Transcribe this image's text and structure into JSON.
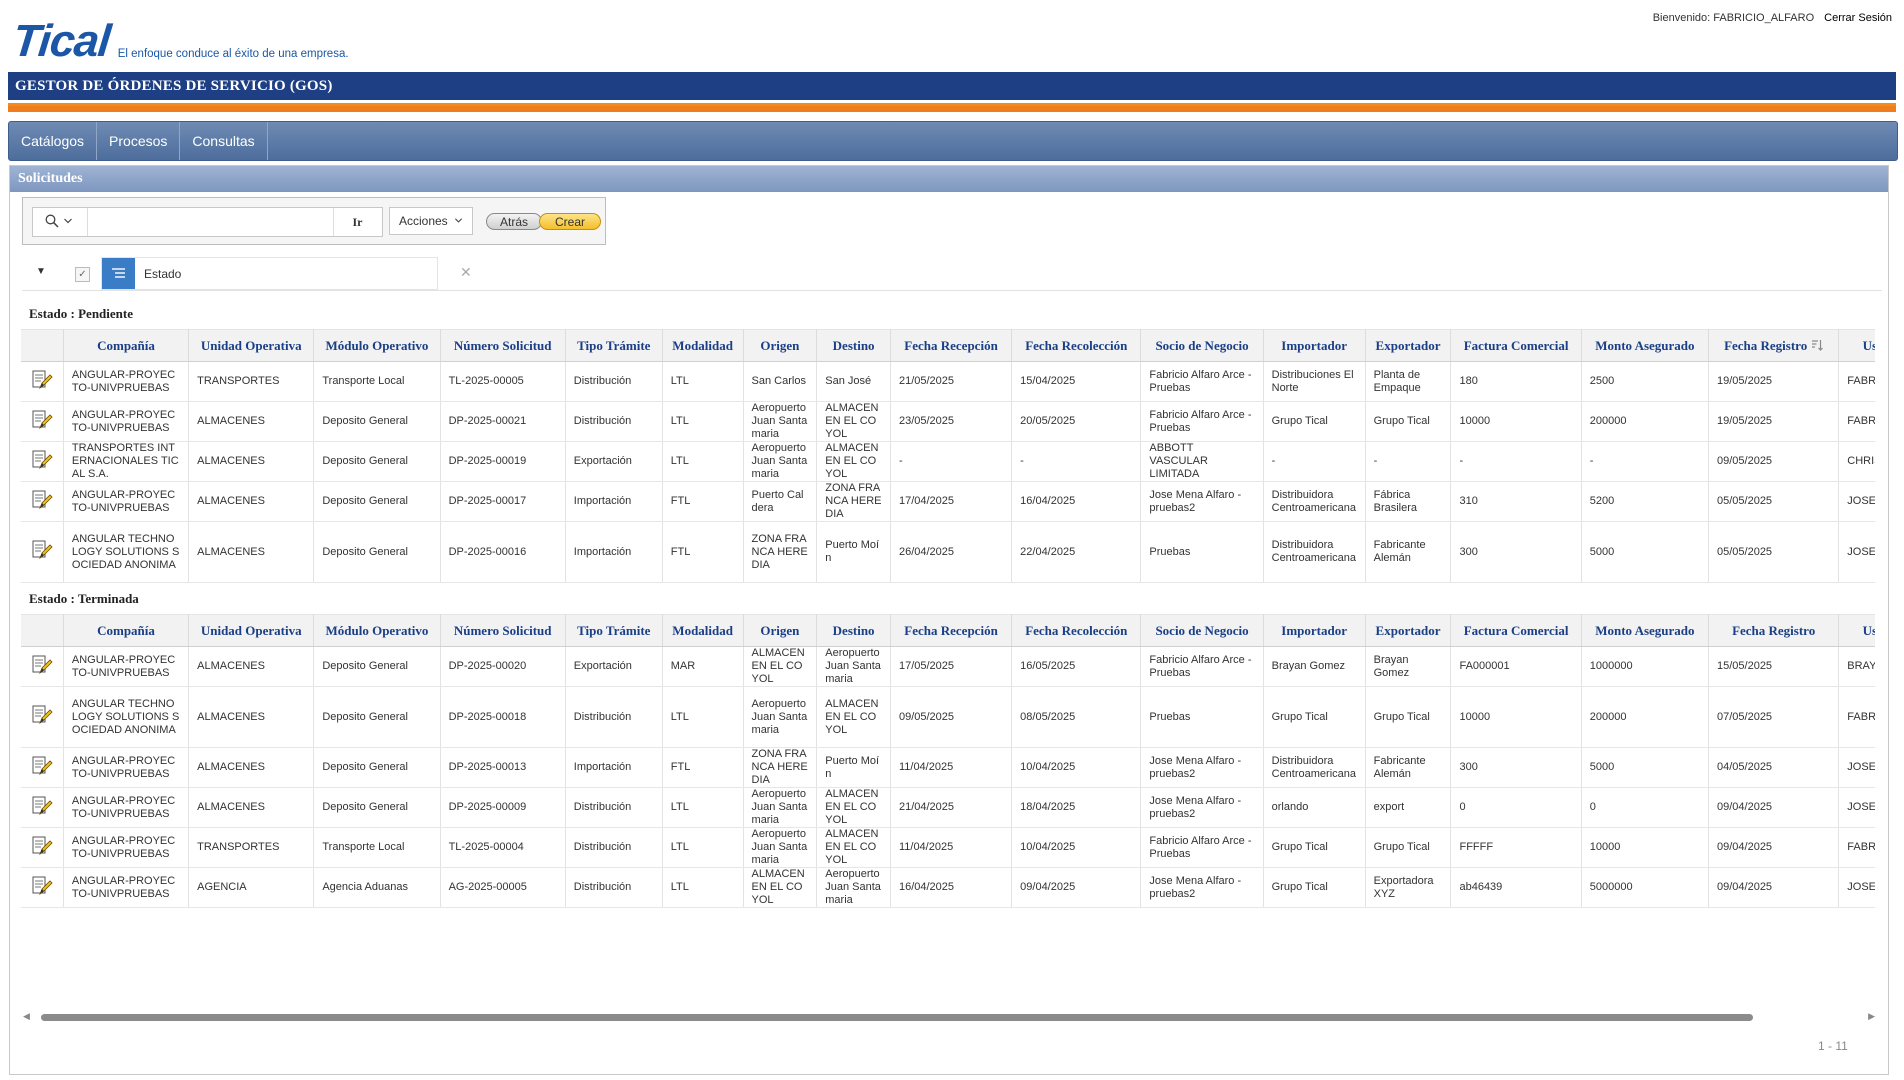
{
  "header": {
    "logo": "Tical",
    "tagline": "El enfoque conduce al éxito de una empresa.",
    "welcome": "Bienvenido: FABRICIO_ALFARO",
    "logout": "Cerrar Sesión",
    "app_title": "GESTOR DE ÓRDENES DE SERVICIO (GOS)"
  },
  "nav": [
    "Catálogos",
    "Procesos",
    "Consultas"
  ],
  "region": {
    "title": "Solicitudes",
    "toolbar": {
      "go": "Ir",
      "actions": "Acciones",
      "back": "Atrás",
      "create": "Crear",
      "search_value": ""
    },
    "filter": {
      "label": "Estado",
      "toggle": "▼",
      "check": "✓",
      "remove": "✕"
    }
  },
  "columns": [
    "Compañía",
    "Unidad Operativa",
    "Módulo Operativo",
    "Número Solicitud",
    "Tipo Trámite",
    "Modalidad",
    "Origen",
    "Destino",
    "Fecha Recepción",
    "Fecha Recolección",
    "Socio de Negocio",
    "Importador",
    "Exportador",
    "Factura Comercial",
    "Monto Asegurado",
    "Fecha Registro",
    "Usuario Registro"
  ],
  "groups": [
    {
      "label": "Estado : Pendiente",
      "rows": [
        [
          "ANGULAR-PROYECTO-UNIVPRUEBAS",
          "TRANSPORTES",
          "Transporte Local",
          "TL-2025-00005",
          "Distribución",
          "LTL",
          "San Carlos",
          "San José",
          "21/05/2025",
          "15/04/2025",
          "Fabricio Alfaro Arce - Pruebas",
          "Distribuciones El Norte",
          "Planta de Empaque",
          "180",
          "2500",
          "19/05/2025",
          "FABRICIO_ALFARO"
        ],
        [
          "ANGULAR-PROYECTO-UNIVPRUEBAS",
          "ALMACENES",
          "Deposito General",
          "DP-2025-00021",
          "Distribución",
          "LTL",
          "Aeropuerto Juan Santamaria",
          "ALMACEN EN EL COYOL",
          "23/05/2025",
          "20/05/2025",
          "Fabricio Alfaro Arce - Pruebas",
          "Grupo Tical",
          "Grupo Tical",
          "10000",
          "200000",
          "19/05/2025",
          "FABRICIO_ALFARO"
        ],
        [
          "TRANSPORTES INTERNACIONALES TICAL S.A.",
          "ALMACENES",
          "Deposito General",
          "DP-2025-00019",
          "Exportación",
          "LTL",
          "Aeropuerto Juan Santamaria",
          "ALMACEN EN EL COYOL",
          "-",
          "-",
          "ABBOTT VASCULAR LIMITADA",
          "-",
          "-",
          "-",
          "-",
          "09/05/2025",
          "CHRISTIAN_RODRIGUEZ"
        ],
        [
          "ANGULAR-PROYECTO-UNIVPRUEBAS",
          "ALMACENES",
          "Deposito General",
          "DP-2025-00017",
          "Importación",
          "FTL",
          "Puerto Caldera",
          "ZONA FRANCA HEREDIA",
          "17/04/2025",
          "16/04/2025",
          "Jose Mena Alfaro - pruebas2",
          "Distribuidora Centroamericana",
          "Fábrica Brasilera",
          "310",
          "5200",
          "05/05/2025",
          "JOSE_MENA"
        ],
        [
          "ANGULAR TECHNOLOGY SOLUTIONS SOCIEDAD ANONIMA",
          "ALMACENES",
          "Deposito General",
          "DP-2025-00016",
          "Importación",
          "FTL",
          "ZONA FRANCA HEREDIA",
          "Puerto Moín",
          "26/04/2025",
          "22/04/2025",
          "Pruebas",
          "Distribuidora Centroamericana",
          "Fabricante Alemán",
          "300",
          "5000",
          "05/05/2025",
          "JOSE_MENA"
        ]
      ]
    },
    {
      "label": "Estado : Terminada",
      "rows": [
        [
          "ANGULAR-PROYECTO-UNIVPRUEBAS",
          "ALMACENES",
          "Deposito General",
          "DP-2025-00020",
          "Exportación",
          "MAR",
          "ALMACEN EN EL COYOL",
          "Aeropuerto Juan Santamaria",
          "17/05/2025",
          "16/05/2025",
          "Fabricio Alfaro Arce - Pruebas",
          "Brayan Gomez",
          "Brayan Gomez",
          "FA000001",
          "1000000",
          "15/05/2025",
          "BRAYAN_GOMEZ"
        ],
        [
          "ANGULAR TECHNOLOGY SOLUTIONS SOCIEDAD ANONIMA",
          "ALMACENES",
          "Deposito General",
          "DP-2025-00018",
          "Distribución",
          "LTL",
          "Aeropuerto Juan Santamaria",
          "ALMACEN EN EL COYOL",
          "09/05/2025",
          "08/05/2025",
          "Pruebas",
          "Grupo Tical",
          "Grupo Tical",
          "10000",
          "200000",
          "07/05/2025",
          "FABRICIO_ALFARO"
        ],
        [
          "ANGULAR-PROYECTO-UNIVPRUEBAS",
          "ALMACENES",
          "Deposito General",
          "DP-2025-00013",
          "Importación",
          "FTL",
          "ZONA FRANCA HEREDIA",
          "Puerto Moín",
          "11/04/2025",
          "10/04/2025",
          "Jose Mena Alfaro - pruebas2",
          "Distribuidora Centroamericana",
          "Fabricante Alemán",
          "300",
          "5000",
          "04/05/2025",
          "JOSE_MENA"
        ],
        [
          "ANGULAR-PROYECTO-UNIVPRUEBAS",
          "ALMACENES",
          "Deposito General",
          "DP-2025-00009",
          "Distribución",
          "LTL",
          "Aeropuerto Juan Santamaria",
          "ALMACEN EN EL COYOL",
          "21/04/2025",
          "18/04/2025",
          "Jose Mena Alfaro - pruebas2",
          "orlando",
          "export",
          "0",
          "0",
          "09/04/2025",
          "JOSE_MENA"
        ],
        [
          "ANGULAR-PROYECTO-UNIVPRUEBAS",
          "TRANSPORTES",
          "Transporte Local",
          "TL-2025-00004",
          "Distribución",
          "LTL",
          "Aeropuerto Juan Santamaria",
          "ALMACEN EN EL COYOL",
          "11/04/2025",
          "10/04/2025",
          "Fabricio Alfaro Arce - Pruebas",
          "Grupo Tical",
          "Grupo Tical",
          "FFFFF",
          "10000",
          "09/04/2025",
          "FABRICIO_ALFARO"
        ],
        [
          "ANGULAR-PROYECTO-UNIVPRUEBAS",
          "AGENCIA",
          "Agencia Aduanas",
          "AG-2025-00005",
          "Distribución",
          "LTL",
          "ALMACEN EN EL COYOL",
          "Aeropuerto Juan Santamaria",
          "16/04/2025",
          "09/04/2025",
          "Jose Mena Alfaro - pruebas2",
          "Grupo Tical",
          "Exportadora XYZ",
          "ab46439",
          "5000000",
          "09/04/2025",
          "JOSE_MENA"
        ]
      ]
    }
  ],
  "pagination": "1 - 11",
  "colors": {
    "brand_blue": "#1b57a6",
    "title_bar": "#1e3f83",
    "accent_orange": "#ef7d1e",
    "header_text": "#1a3f86"
  }
}
